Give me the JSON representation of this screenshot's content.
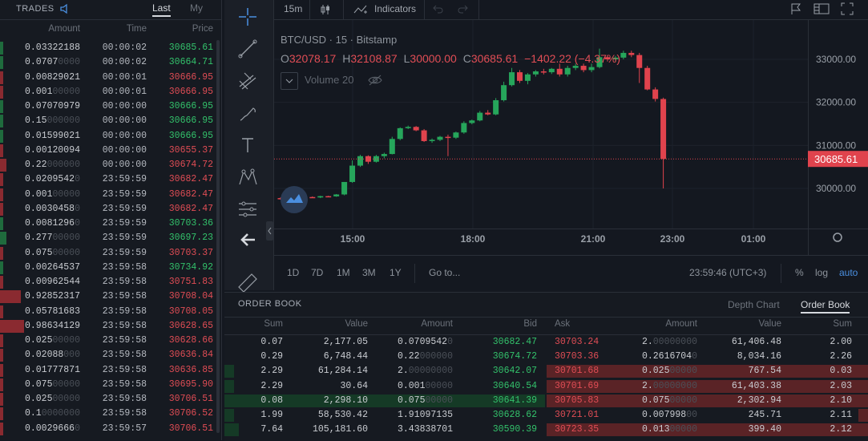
{
  "trades": {
    "title": "TRADES",
    "tabs": [
      "Last",
      "My"
    ],
    "columns": [
      "Amount",
      "Time",
      "Price"
    ],
    "rows": [
      {
        "amount": "0.03322188",
        "dim": "",
        "time": "00:00:02",
        "price": "30685.61",
        "dir": "up",
        "bar": 4
      },
      {
        "amount": "0.0707",
        "dim": "0000",
        "time": "00:00:02",
        "price": "30664.71",
        "dir": "up",
        "bar": 4
      },
      {
        "amount": "0.00829021",
        "dim": "",
        "time": "00:00:01",
        "price": "30666.95",
        "dir": "down",
        "bar": 4
      },
      {
        "amount": "0.001",
        "dim": "00000",
        "time": "00:00:01",
        "price": "30666.95",
        "dir": "down",
        "bar": 4
      },
      {
        "amount": "0.07070979",
        "dim": "",
        "time": "00:00:00",
        "price": "30666.95",
        "dir": "up",
        "bar": 4
      },
      {
        "amount": "0.15",
        "dim": "000000",
        "time": "00:00:00",
        "price": "30666.95",
        "dir": "up",
        "bar": 4
      },
      {
        "amount": "0.01599021",
        "dim": "",
        "time": "00:00:00",
        "price": "30666.95",
        "dir": "up",
        "bar": 4
      },
      {
        "amount": "0.00120094",
        "dim": "",
        "time": "00:00:00",
        "price": "30655.37",
        "dir": "down",
        "bar": 4
      },
      {
        "amount": "0.22",
        "dim": "000000",
        "time": "00:00:00",
        "price": "30674.72",
        "dir": "down",
        "bar": 8
      },
      {
        "amount": "0.0209542",
        "dim": "0",
        "time": "23:59:59",
        "price": "30682.47",
        "dir": "down",
        "bar": 4
      },
      {
        "amount": "0.001",
        "dim": "00000",
        "time": "23:59:59",
        "price": "30682.47",
        "dir": "down",
        "bar": 4
      },
      {
        "amount": "0.0030458",
        "dim": "0",
        "time": "23:59:59",
        "price": "30682.47",
        "dir": "down",
        "bar": 4
      },
      {
        "amount": "0.0081296",
        "dim": "0",
        "time": "23:59:59",
        "price": "30703.36",
        "dir": "up",
        "bar": 4
      },
      {
        "amount": "0.277",
        "dim": "00000",
        "time": "23:59:59",
        "price": "30697.23",
        "dir": "up",
        "bar": 8
      },
      {
        "amount": "0.075",
        "dim": "00000",
        "time": "23:59:59",
        "price": "30703.37",
        "dir": "down",
        "bar": 4
      },
      {
        "amount": "0.00264537",
        "dim": "",
        "time": "23:59:58",
        "price": "30734.92",
        "dir": "up",
        "bar": 4
      },
      {
        "amount": "0.00962544",
        "dim": "",
        "time": "23:59:58",
        "price": "30751.83",
        "dir": "down",
        "bar": 4
      },
      {
        "amount": "0.92852317",
        "dim": "",
        "time": "23:59:58",
        "price": "30708.04",
        "dir": "down",
        "bar": 26
      },
      {
        "amount": "0.05781683",
        "dim": "",
        "time": "23:59:58",
        "price": "30708.05",
        "dir": "down",
        "bar": 4
      },
      {
        "amount": "0.98634129",
        "dim": "",
        "time": "23:59:58",
        "price": "30628.65",
        "dir": "down",
        "bar": 30
      },
      {
        "amount": "0.025",
        "dim": "00000",
        "time": "23:59:58",
        "price": "30628.66",
        "dir": "down",
        "bar": 4
      },
      {
        "amount": "0.02088",
        "dim": "000",
        "time": "23:59:58",
        "price": "30636.84",
        "dir": "down",
        "bar": 4
      },
      {
        "amount": "0.01777871",
        "dim": "",
        "time": "23:59:58",
        "price": "30636.85",
        "dir": "down",
        "bar": 4
      },
      {
        "amount": "0.075",
        "dim": "00000",
        "time": "23:59:58",
        "price": "30695.90",
        "dir": "down",
        "bar": 4
      },
      {
        "amount": "0.025",
        "dim": "00000",
        "time": "23:59:58",
        "price": "30706.51",
        "dir": "down",
        "bar": 4
      },
      {
        "amount": "0.1",
        "dim": "0000000",
        "time": "23:59:58",
        "price": "30706.52",
        "dir": "down",
        "bar": 4
      },
      {
        "amount": "0.0029666",
        "dim": "0",
        "time": "23:59:57",
        "price": "30706.51",
        "dir": "down",
        "bar": 4
      }
    ]
  },
  "chart": {
    "toolbar": {
      "interval": "15m",
      "indicators": "Indicators"
    },
    "symbol_line": "BTC/USD · 15 · Bitstamp",
    "ohlc": {
      "o_label": "O",
      "o": "32078.17",
      "h_label": "H",
      "h": "32108.87",
      "l_label": "L",
      "l": "30000.00",
      "c_label": "C",
      "c": "30685.61",
      "change": "−1402.22 (−4.37%)"
    },
    "volume_label": "Volume 20",
    "last_price": "30685.61",
    "price_axis": [
      "33000.00",
      "32000.00",
      "31000.00",
      "30000.00"
    ],
    "time_axis": [
      "15:00",
      "18:00",
      "21:00",
      "23:00",
      "01:00"
    ],
    "ranges": [
      "1D",
      "7D",
      "1M",
      "3M",
      "1Y"
    ],
    "goto": "Go to...",
    "clock": "23:59:46 (UTC+3)",
    "scale_opts": [
      "%",
      "log",
      "auto"
    ],
    "colors": {
      "up": "#26a65b",
      "down": "#e0434d",
      "accent": "#4a8fe0"
    }
  },
  "chart_data": {
    "type": "candlestick",
    "title": "BTC/USD · 15 · Bitstamp",
    "ylim": [
      29700,
      33300
    ],
    "candles": [
      {
        "t": "12:45",
        "o": 29775,
        "h": 29790,
        "l": 29740,
        "c": 29770
      },
      {
        "t": "13:00",
        "o": 29770,
        "h": 29800,
        "l": 29750,
        "c": 29785
      },
      {
        "t": "13:15",
        "o": 29785,
        "h": 29800,
        "l": 29765,
        "c": 29775
      },
      {
        "t": "13:30",
        "o": 29775,
        "h": 29810,
        "l": 29760,
        "c": 29800
      },
      {
        "t": "13:45",
        "o": 29800,
        "h": 29815,
        "l": 29780,
        "c": 29790
      },
      {
        "t": "14:00",
        "o": 29790,
        "h": 29830,
        "l": 29775,
        "c": 29820
      },
      {
        "t": "14:15",
        "o": 29820,
        "h": 29830,
        "l": 29795,
        "c": 29815
      },
      {
        "t": "14:30",
        "o": 29815,
        "h": 29870,
        "l": 29805,
        "c": 29860
      },
      {
        "t": "14:45",
        "o": 29860,
        "h": 30150,
        "l": 29840,
        "c": 30150
      },
      {
        "t": "15:00",
        "o": 30150,
        "h": 30650,
        "l": 30130,
        "c": 30530
      },
      {
        "t": "15:15",
        "o": 30530,
        "h": 30780,
        "l": 30500,
        "c": 30750
      },
      {
        "t": "15:30",
        "o": 30750,
        "h": 30770,
        "l": 30570,
        "c": 30620
      },
      {
        "t": "15:45",
        "o": 30620,
        "h": 30780,
        "l": 30600,
        "c": 30750
      },
      {
        "t": "16:00",
        "o": 30750,
        "h": 30830,
        "l": 30700,
        "c": 30800
      },
      {
        "t": "16:15",
        "o": 30800,
        "h": 31200,
        "l": 30790,
        "c": 31150
      },
      {
        "t": "16:30",
        "o": 31150,
        "h": 31420,
        "l": 31120,
        "c": 31400
      },
      {
        "t": "16:45",
        "o": 31400,
        "h": 31460,
        "l": 31380,
        "c": 31430
      },
      {
        "t": "17:00",
        "o": 31430,
        "h": 31450,
        "l": 31330,
        "c": 31350
      },
      {
        "t": "17:15",
        "o": 31350,
        "h": 31380,
        "l": 31080,
        "c": 31100
      },
      {
        "t": "17:30",
        "o": 31100,
        "h": 31160,
        "l": 31060,
        "c": 31130
      },
      {
        "t": "17:45",
        "o": 31130,
        "h": 31220,
        "l": 31100,
        "c": 31200
      },
      {
        "t": "18:00",
        "o": 31200,
        "h": 31250,
        "l": 30750,
        "c": 31180
      },
      {
        "t": "18:15",
        "o": 31180,
        "h": 31320,
        "l": 31150,
        "c": 31300
      },
      {
        "t": "18:30",
        "o": 31300,
        "h": 31560,
        "l": 31270,
        "c": 31520
      },
      {
        "t": "18:45",
        "o": 31520,
        "h": 31600,
        "l": 31490,
        "c": 31580
      },
      {
        "t": "19:00",
        "o": 31580,
        "h": 31800,
        "l": 31560,
        "c": 31760
      },
      {
        "t": "19:15",
        "o": 31760,
        "h": 31820,
        "l": 31700,
        "c": 31720
      },
      {
        "t": "19:30",
        "o": 31720,
        "h": 32100,
        "l": 31700,
        "c": 32050
      },
      {
        "t": "19:45",
        "o": 32050,
        "h": 32480,
        "l": 32020,
        "c": 32400
      },
      {
        "t": "20:00",
        "o": 32400,
        "h": 32800,
        "l": 32370,
        "c": 32700
      },
      {
        "t": "20:15",
        "o": 32700,
        "h": 32750,
        "l": 32450,
        "c": 32500
      },
      {
        "t": "20:30",
        "o": 32500,
        "h": 32680,
        "l": 32420,
        "c": 32650
      },
      {
        "t": "20:45",
        "o": 32650,
        "h": 32750,
        "l": 32600,
        "c": 32720
      },
      {
        "t": "21:00",
        "o": 32720,
        "h": 32780,
        "l": 32650,
        "c": 32700
      },
      {
        "t": "21:15",
        "o": 32700,
        "h": 32800,
        "l": 32660,
        "c": 32780
      },
      {
        "t": "21:30",
        "o": 32780,
        "h": 32900,
        "l": 32600,
        "c": 32650
      },
      {
        "t": "21:45",
        "o": 32650,
        "h": 32850,
        "l": 32600,
        "c": 32800
      },
      {
        "t": "22:00",
        "o": 32800,
        "h": 32900,
        "l": 32750,
        "c": 32850
      },
      {
        "t": "22:15",
        "o": 32850,
        "h": 32900,
        "l": 32700,
        "c": 32750
      },
      {
        "t": "22:30",
        "o": 32750,
        "h": 32900,
        "l": 32700,
        "c": 32820
      },
      {
        "t": "22:45",
        "o": 32820,
        "h": 33250,
        "l": 32790,
        "c": 33050
      },
      {
        "t": "23:00",
        "o": 33050,
        "h": 33100,
        "l": 32950,
        "c": 33000
      },
      {
        "t": "23:15",
        "o": 33000,
        "h": 33080,
        "l": 32940,
        "c": 33040
      },
      {
        "t": "23:30",
        "o": 33040,
        "h": 33200,
        "l": 33000,
        "c": 33150
      },
      {
        "t": "23:45",
        "o": 33150,
        "h": 33200,
        "l": 33050,
        "c": 33100
      },
      {
        "t": "00:00",
        "o": 33100,
        "h": 33150,
        "l": 32450,
        "c": 32800
      },
      {
        "t": "00:15",
        "o": 32800,
        "h": 32850,
        "l": 32280,
        "c": 32300
      },
      {
        "t": "00:30",
        "o": 32300,
        "h": 32350,
        "l": 32020,
        "c": 32080
      },
      {
        "t": "00:45",
        "o": 32078,
        "h": 32109,
        "l": 30000,
        "c": 30686
      }
    ]
  },
  "orderbook": {
    "title": "ORDER BOOK",
    "tabs": [
      "Depth Chart",
      "Order Book"
    ],
    "columns": [
      "Sum",
      "Value",
      "Amount",
      "Bid",
      "Ask",
      "Amount",
      "Value",
      "Sum"
    ],
    "rows": [
      {
        "bsum": "0.07",
        "bval": "2,177.05",
        "bamt": "0.0709542",
        "bamt_dim": "0",
        "bid": "30682.47",
        "ask": "30703.24",
        "aamt": "2.",
        "aamt_dim": "00000000",
        "aval": "61,406.48",
        "asum": "2.00",
        "bbar": 0,
        "abar": 0,
        "askhl": false,
        "bidhl": false
      },
      {
        "bsum": "0.29",
        "bval": "6,748.44",
        "bamt": "0.22",
        "bamt_dim": "000000",
        "bid": "30674.72",
        "ask": "30703.36",
        "aamt": "0.2616704",
        "aamt_dim": "0",
        "aval": "8,034.16",
        "asum": "2.26",
        "bbar": 0,
        "abar": 0,
        "askhl": false,
        "bidhl": false
      },
      {
        "bsum": "2.29",
        "bval": "61,284.14",
        "bamt": "2.",
        "bamt_dim": "00000000",
        "bid": "30642.07",
        "ask": "30701.68",
        "aamt": "0.025",
        "aamt_dim": "00000",
        "aval": "767.54",
        "asum": "0.03",
        "bbar": 12,
        "abar": 0,
        "askhl": true,
        "bidhl": false
      },
      {
        "bsum": "2.29",
        "bval": "30.64",
        "bamt": "0.001",
        "bamt_dim": "00000",
        "bid": "30640.54",
        "ask": "30701.69",
        "aamt": "2.",
        "aamt_dim": "00000000",
        "aval": "61,403.38",
        "asum": "2.03",
        "bbar": 12,
        "abar": 12,
        "askhl": true,
        "bidhl": false
      },
      {
        "bsum": "0.08",
        "bval": "2,298.10",
        "bamt": "0.075",
        "bamt_dim": "00000",
        "bid": "30641.39",
        "ask": "30705.83",
        "aamt": "0.075",
        "aamt_dim": "00000",
        "aval": "2,302.94",
        "asum": "2.10",
        "bbar": 0,
        "abar": 12,
        "askhl": true,
        "bidhl": true
      },
      {
        "bsum": "1.99",
        "bval": "58,530.42",
        "bamt": "1.91097135",
        "bamt_dim": "",
        "bid": "30628.62",
        "ask": "30721.01",
        "aamt": "0.007998",
        "aamt_dim": "00",
        "aval": "245.71",
        "asum": "2.11",
        "bbar": 12,
        "abar": 12,
        "askhl": false,
        "bidhl": false
      },
      {
        "bsum": "7.64",
        "bval": "105,181.60",
        "bamt": "3.43838701",
        "bamt_dim": "",
        "bid": "30590.39",
        "ask": "30723.35",
        "aamt": "0.013",
        "aamt_dim": "00000",
        "aval": "399.40",
        "asum": "2.12",
        "bbar": 18,
        "abar": 12,
        "askhl": true,
        "bidhl": false
      }
    ]
  }
}
